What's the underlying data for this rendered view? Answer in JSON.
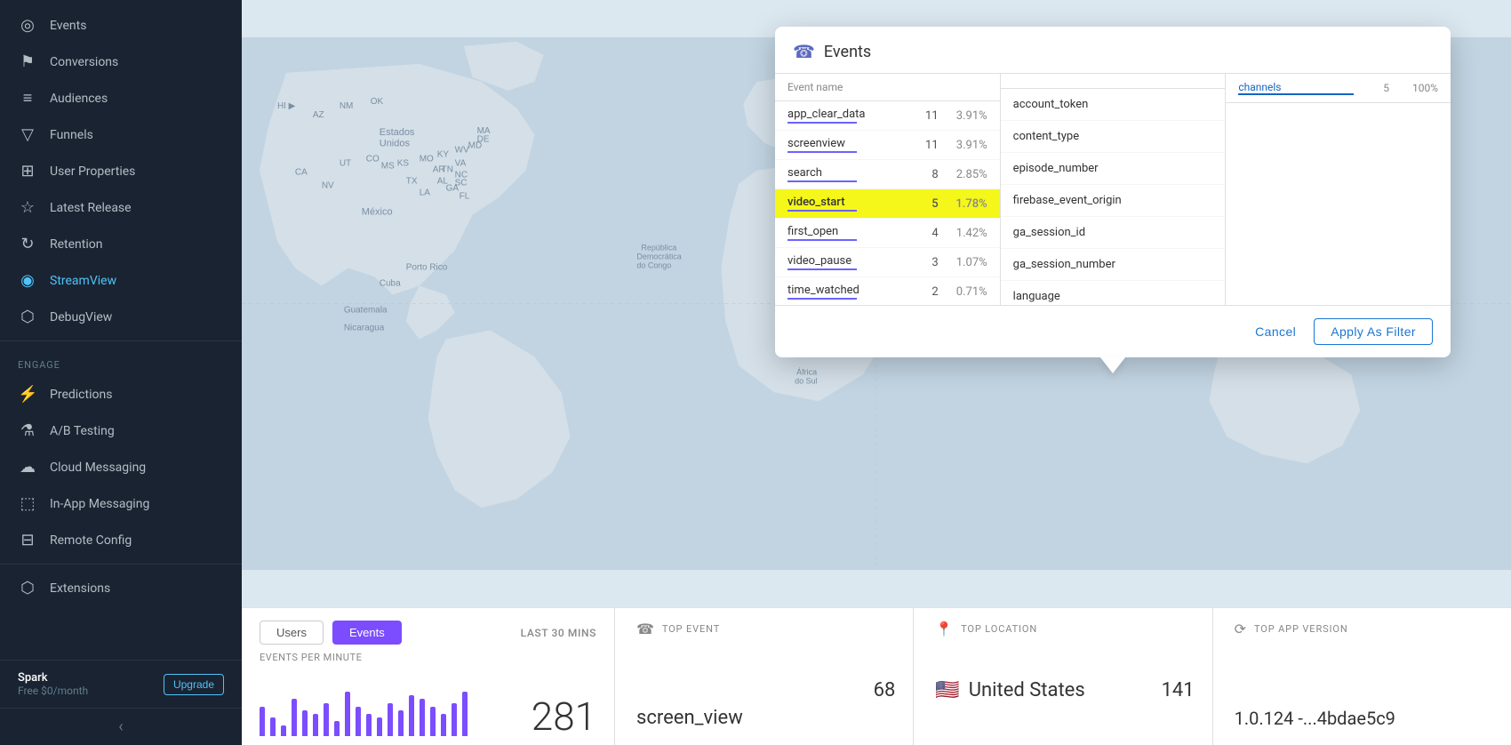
{
  "sidebar": {
    "items_top": [
      {
        "id": "events",
        "label": "Events",
        "icon": "◎"
      },
      {
        "id": "conversions",
        "label": "Conversions",
        "icon": "⚑"
      },
      {
        "id": "audiences",
        "label": "Audiences",
        "icon": "≡"
      },
      {
        "id": "funnels",
        "label": "Funnels",
        "icon": "▽"
      },
      {
        "id": "user-properties",
        "label": "User Properties",
        "icon": "⊞"
      },
      {
        "id": "latest-release",
        "label": "Latest Release",
        "icon": "☆"
      },
      {
        "id": "retention",
        "label": "Retention",
        "icon": "↻"
      },
      {
        "id": "streamview",
        "label": "StreamView",
        "icon": "◉"
      }
    ],
    "debugview": {
      "label": "DebugView",
      "icon": "⬡"
    },
    "engage_label": "Engage",
    "items_engage": [
      {
        "id": "predictions",
        "label": "Predictions",
        "icon": "⚡"
      },
      {
        "id": "ab-testing",
        "label": "A/B Testing",
        "icon": "⚗"
      },
      {
        "id": "cloud-messaging",
        "label": "Cloud Messaging",
        "icon": "☁"
      },
      {
        "id": "in-app-messaging",
        "label": "In-App Messaging",
        "icon": "⬚"
      },
      {
        "id": "remote-config",
        "label": "Remote Config",
        "icon": "⊟"
      }
    ],
    "extensions": {
      "label": "Extensions",
      "icon": "⬡"
    },
    "footer": {
      "plan": "Spark",
      "sub": "Free $0/month",
      "upgrade_label": "Upgrade"
    },
    "collapse_icon": "‹"
  },
  "popup": {
    "title": "Events",
    "icon": "☎",
    "col1_header": {
      "name": "Event name",
      "count": "",
      "pct": ""
    },
    "events": [
      {
        "name": "app_clear_data",
        "count": "11",
        "pct": "3.91%",
        "highlighted": false
      },
      {
        "name": "screenview",
        "count": "11",
        "pct": "3.91%",
        "highlighted": false
      },
      {
        "name": "search",
        "count": "8",
        "pct": "2.85%",
        "highlighted": false
      },
      {
        "name": "video_start",
        "count": "5",
        "pct": "1.78%",
        "highlighted": true
      },
      {
        "name": "first_open",
        "count": "4",
        "pct": "1.42%",
        "highlighted": false
      },
      {
        "name": "video_pause",
        "count": "3",
        "pct": "1.07%",
        "highlighted": false
      },
      {
        "name": "time_watched",
        "count": "2",
        "pct": "0.71%",
        "highlighted": false
      }
    ],
    "params": [
      "account_token",
      "content_type",
      "episode_number",
      "firebase_event_origin",
      "ga_session_id",
      "ga_session_number",
      "language"
    ],
    "col3": {
      "header_name": "channels",
      "header_count": "5",
      "header_pct": "100%"
    },
    "cancel_label": "Cancel",
    "apply_label": "Apply As Filter"
  },
  "bottom": {
    "tab_users": "Users",
    "tab_events": "Events",
    "last30_label": "LAST 30 MINS",
    "events_per_min": "EVENTS PER MINUTE",
    "count": "281",
    "chart_bars": [
      8,
      5,
      3,
      10,
      7,
      6,
      9,
      4,
      12,
      8,
      6,
      5,
      9,
      7,
      11,
      10,
      8,
      6,
      9,
      12
    ],
    "top_event_label": "TOP EVENT",
    "top_event_name": "screen_view",
    "top_event_count": "68",
    "top_location_label": "TOP LOCATION",
    "top_location_flag": "🇺🇸",
    "top_location_name": "United States",
    "top_location_count": "141",
    "top_version_label": "TOP APP VERSION",
    "top_version_value": "1.0.124 -...4bdae5c9"
  }
}
